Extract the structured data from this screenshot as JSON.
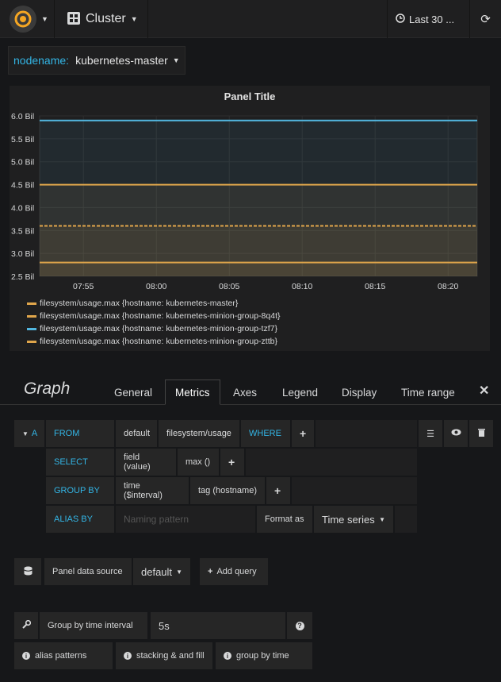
{
  "nav": {
    "dashboard_title": "Cluster",
    "time_range": "Last 30 ...",
    "icons": {
      "logo": "grafana-logo-icon",
      "dash": "dashboard-grid-icon",
      "clock": "clock-icon",
      "refresh": "refresh-icon"
    }
  },
  "template_var": {
    "label": "nodename:",
    "value": "kubernetes-master"
  },
  "panel": {
    "title": "Panel Title",
    "chart_data": {
      "type": "line",
      "title": "Panel Title",
      "xlabel": "",
      "ylabel": "",
      "x_ticks": [
        "07:55",
        "08:00",
        "08:05",
        "08:10",
        "08:15",
        "08:20"
      ],
      "y_ticks": [
        "6.0 Bil",
        "5.5 Bil",
        "5.0 Bil",
        "4.5 Bil",
        "4.0 Bil",
        "3.5 Bil",
        "3.0 Bil",
        "2.5 Bil"
      ],
      "ylim": [
        2.5,
        6.0
      ],
      "x_start": "07:52",
      "x_end": "08:22",
      "series": [
        {
          "name": "filesystem/usage.max {hostname: kubernetes-master}",
          "color": "#e0a64b",
          "value": 2.8
        },
        {
          "name": "filesystem/usage.max {hostname: kubernetes-minion-group-8q4t}",
          "color": "#e0a64b",
          "value": 4.5
        },
        {
          "name": "filesystem/usage.max {hostname: kubernetes-minion-group-tzf7}",
          "color": "#52b7e0",
          "value": 5.9
        },
        {
          "name": "filesystem/usage.max {hostname: kubernetes-minion-group-zttb}",
          "color": "#e0a64b",
          "value": 3.6,
          "dashed": true
        }
      ]
    }
  },
  "editor": {
    "title": "Graph",
    "tabs": [
      "General",
      "Metrics",
      "Axes",
      "Legend",
      "Display",
      "Time range"
    ],
    "active_tab": "Metrics",
    "query": {
      "ref": "A",
      "from_label": "FROM",
      "from_policy": "default",
      "from_measurement": "filesystem/usage",
      "where_label": "WHERE",
      "select_label": "SELECT",
      "select_field": "field (value)",
      "select_func": "max ()",
      "groupby_label": "GROUP BY",
      "groupby_time": "time ($interval)",
      "groupby_tag": "tag (hostname)",
      "alias_label": "ALIAS BY",
      "alias_placeholder": "Naming pattern",
      "format_label": "Format as",
      "format_value": "Time series"
    },
    "datasource": {
      "label": "Panel data source",
      "value": "default",
      "add_query": "Add query"
    },
    "options": {
      "interval_label": "Group by time interval",
      "interval_value": "5s",
      "help1": "alias patterns",
      "help2": "stacking & and fill",
      "help3": "group by time"
    }
  }
}
